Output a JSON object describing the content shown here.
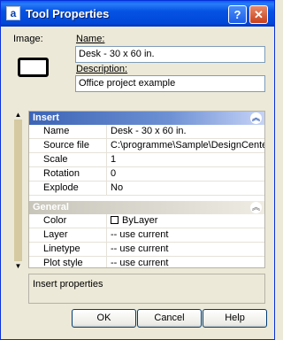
{
  "window": {
    "title": "Tool Properties",
    "app_icon_glyph": "a",
    "help_glyph": "?",
    "close_glyph": "✕"
  },
  "top": {
    "image_label": "Image:",
    "name_label": "Name:",
    "name_value": "Desk - 30 x 60 in.",
    "description_label": "Description:",
    "description_value": "Office project example"
  },
  "scroll": {
    "up": "▲",
    "down": "▼"
  },
  "sections": {
    "insert": {
      "title": "Insert",
      "collapse_glyph": "︽",
      "rows": [
        {
          "key": "Name",
          "value": "Desk - 30 x 60 in."
        },
        {
          "key": "Source file",
          "value": "C:\\programme\\Sample\\DesignCenter\\..."
        },
        {
          "key": "Scale",
          "value": "1"
        },
        {
          "key": "Rotation",
          "value": "0"
        },
        {
          "key": "Explode",
          "value": "No"
        }
      ]
    },
    "general": {
      "title": "General",
      "collapse_glyph": "︽",
      "rows": [
        {
          "key": "Color",
          "value": "ByLayer"
        },
        {
          "key": "Layer",
          "value": "-- use current"
        },
        {
          "key": "Linetype",
          "value": "-- use current"
        },
        {
          "key": "Plot style",
          "value": "-- use current"
        }
      ]
    }
  },
  "help_text": "Insert properties",
  "buttons": {
    "ok": "OK",
    "cancel": "Cancel",
    "help": "Help"
  }
}
